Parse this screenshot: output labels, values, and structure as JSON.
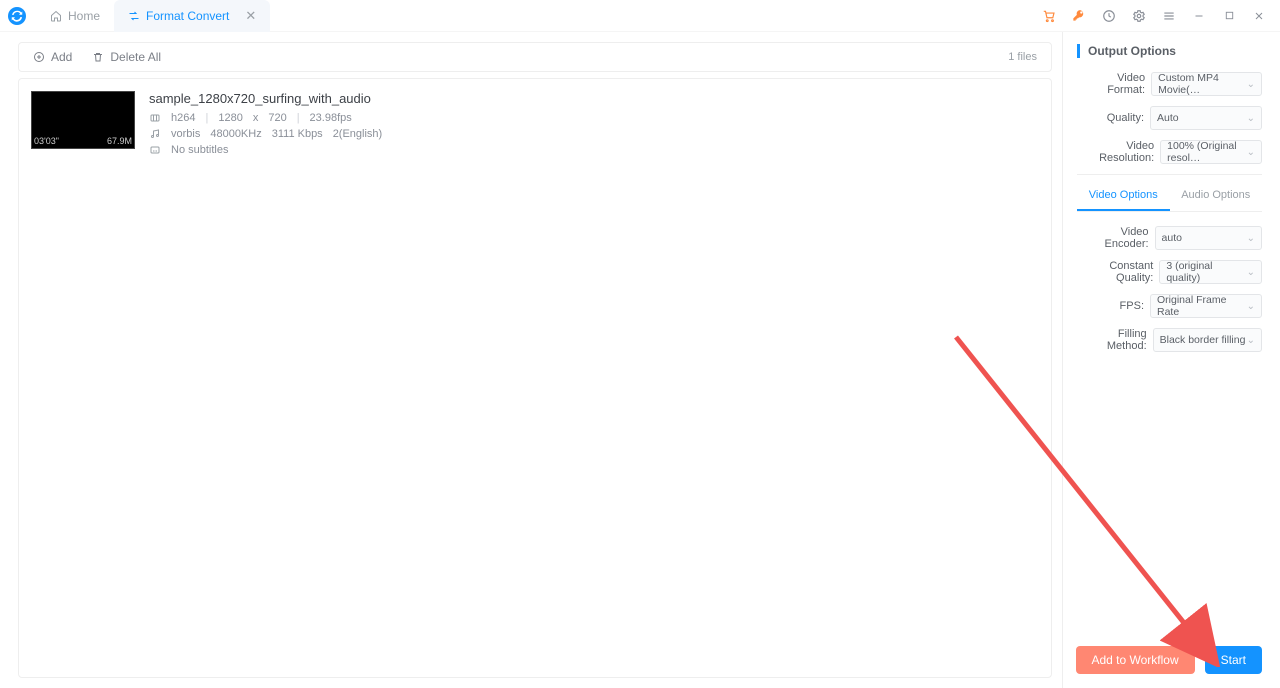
{
  "titlebar": {
    "tabs": [
      {
        "label": "Home",
        "active": false
      },
      {
        "label": "Format Convert",
        "active": true
      }
    ]
  },
  "toolbar": {
    "add_label": "Add",
    "delete_all_label": "Delete All",
    "file_count": "1 files"
  },
  "file": {
    "title": "sample_1280x720_surfing_with_audio",
    "duration": "03'03\"",
    "size": "67.9M",
    "codec": "h264",
    "width": "1280",
    "x": "x",
    "height": "720",
    "fps": "23.98fps",
    "audio_codec": "vorbis",
    "audio_rate": "48000KHz",
    "audio_bitrate": "3111 Kbps",
    "audio_lang": "2(English)",
    "subtitles": "No subtitles"
  },
  "output": {
    "section_title": "Output Options",
    "video_format_label": "Video Format:",
    "video_format_value": "Custom MP4 Movie(…",
    "quality_label": "Quality:",
    "quality_value": "Auto",
    "resolution_label": "Video Resolution:",
    "resolution_value": "100% (Original resol…",
    "tab_video": "Video Options",
    "tab_audio": "Audio Options",
    "encoder_label": "Video Encoder:",
    "encoder_value": "auto",
    "cq_label": "Constant Quality:",
    "cq_value": "3 (original quality)",
    "fps_label": "FPS:",
    "fps_value": "Original Frame Rate",
    "fill_label": "Filling Method:",
    "fill_value": "Black border filling"
  },
  "actions": {
    "add_to_workflow": "Add to Workflow",
    "start": "Start"
  }
}
